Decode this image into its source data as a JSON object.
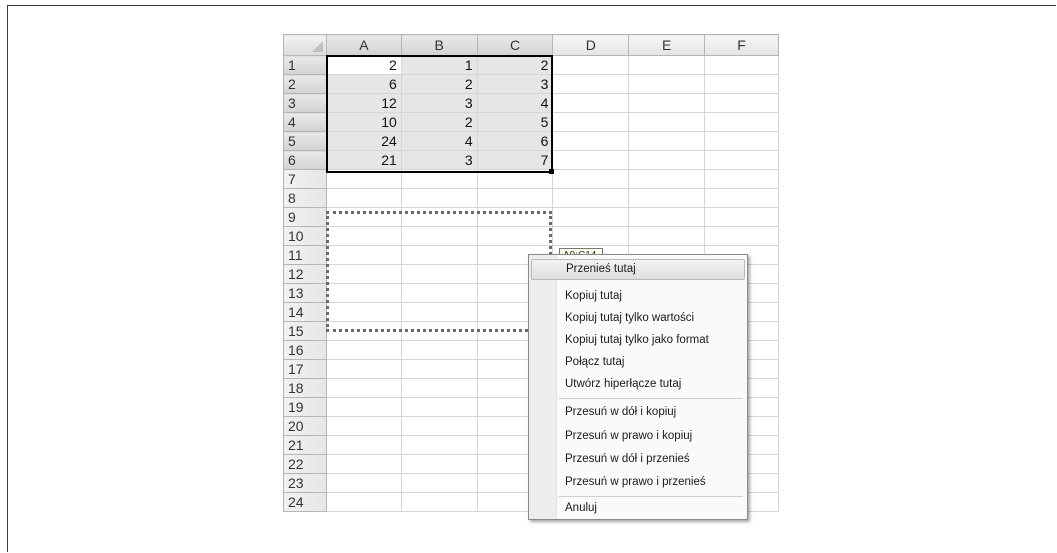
{
  "columns": [
    "A",
    "B",
    "C",
    "D",
    "E",
    "F"
  ],
  "rows": [
    "1",
    "2",
    "3",
    "4",
    "5",
    "6",
    "7",
    "8",
    "9",
    "10",
    "11",
    "12",
    "13",
    "14",
    "15",
    "16",
    "17",
    "18",
    "19",
    "20",
    "21",
    "22",
    "23",
    "24"
  ],
  "cells": [
    [
      "2",
      "1",
      "2"
    ],
    [
      "6",
      "2",
      "3"
    ],
    [
      "12",
      "3",
      "4"
    ],
    [
      "10",
      "2",
      "5"
    ],
    [
      "24",
      "4",
      "6"
    ],
    [
      "21",
      "3",
      "7"
    ]
  ],
  "drag_tooltip": "A9:C14",
  "context_menu": {
    "items": [
      {
        "label": "Przenieś tutaj"
      },
      {
        "label": "Kopiuj tutaj"
      },
      {
        "label": "Kopiuj tutaj tylko wartości"
      },
      {
        "label": "Kopiuj tutaj tylko jako format"
      },
      {
        "label": "Połącz tutaj"
      },
      {
        "label": "Utwórz hiperłącze tutaj"
      },
      {
        "label": "Przesuń w dół i kopiuj"
      },
      {
        "label": "Przesuń w prawo i kopiuj"
      },
      {
        "label": "Przesuń w dół i przenieś"
      },
      {
        "label": "Przesuń w prawo i przenieś"
      },
      {
        "label": "Anuluj"
      }
    ]
  }
}
